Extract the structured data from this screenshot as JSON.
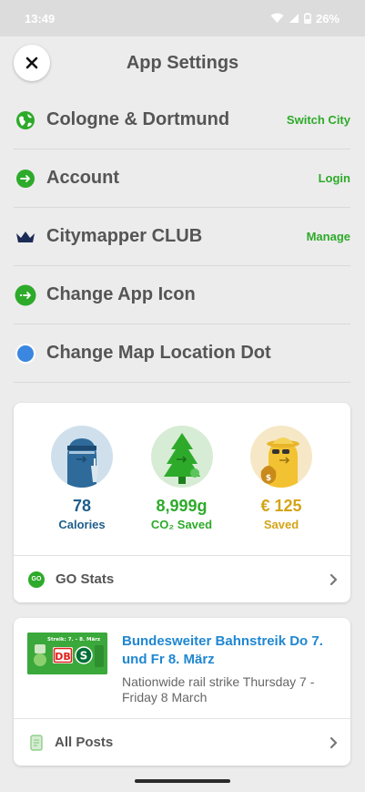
{
  "status_bar": {
    "time": "13:49",
    "battery": "26%"
  },
  "header": {
    "title": "App Settings",
    "close_icon": "close-icon"
  },
  "settings": [
    {
      "label": "Cologne & Dortmund",
      "action": "Switch City",
      "icon": "globe-icon"
    },
    {
      "label": "Account",
      "action": "Login",
      "icon": "citymapper-arrow-icon"
    },
    {
      "label": "Citymapper CLUB",
      "action": "Manage",
      "icon": "crown-icon"
    },
    {
      "label": "Change App Icon",
      "action": "",
      "icon": "citymapper-arrow-icon"
    },
    {
      "label": "Change Map Location Dot",
      "action": "",
      "icon": "location-dot-icon"
    }
  ],
  "stats": {
    "items": [
      {
        "value": "78",
        "caption": "Calories",
        "color": "#1f5f8b"
      },
      {
        "value": "8,999g",
        "caption": "CO₂ Saved",
        "color": "#2eaa2a"
      },
      {
        "value": "€ 125",
        "caption": "Saved",
        "color": "#d4a418"
      }
    ],
    "go_badge": "GO",
    "go_label": "GO Stats"
  },
  "news": {
    "thumb_text_top": "Streik: 7. – 8. März",
    "thumb_logo_db": "DB",
    "thumb_logo_s": "S",
    "title": "Bundesweiter Bahnstreik Do 7. und Fr 8. März",
    "subtitle": "Nationwide rail strike Thursday 7 - Friday 8 March",
    "posts_label": "All Posts"
  },
  "colors": {
    "accent_green": "#2eaa2a",
    "link_blue": "#1f87d2",
    "club_navy": "#1c2b55",
    "dot_blue": "#3a86e0"
  }
}
